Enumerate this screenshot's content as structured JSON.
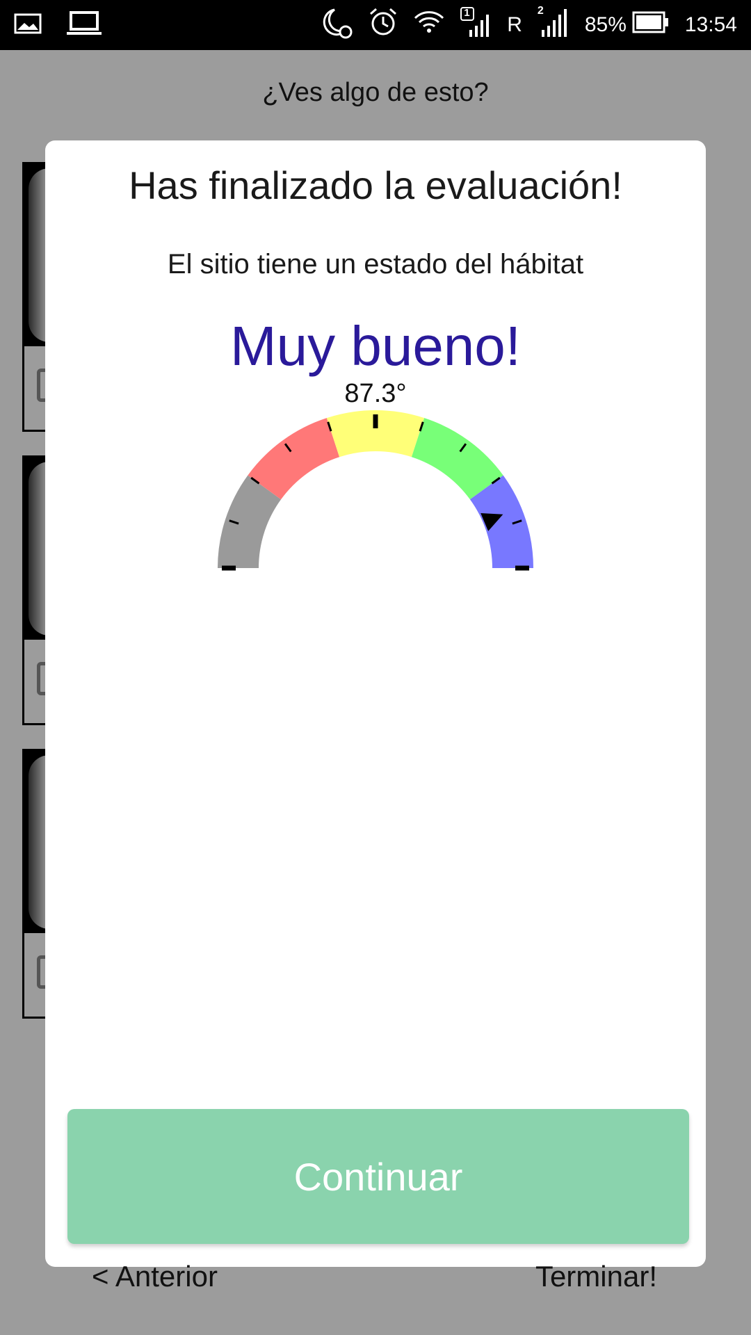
{
  "status_bar": {
    "wifi_sim_badge": "1",
    "roaming": "R",
    "sim2_badge": "2",
    "battery": "85%",
    "time": "13:54"
  },
  "page": {
    "question": "¿Ves algo de esto?"
  },
  "dialog": {
    "title": "Has finalizado la evaluación!",
    "subtitle": "El sitio tiene un estado del hábitat",
    "result": "Muy bueno!",
    "gauge": {
      "value_label": "87.3°",
      "value": 87.3,
      "min": 0,
      "max": 100,
      "segments": [
        {
          "color": "#9a9a9a"
        },
        {
          "color": "#ff7878"
        },
        {
          "color": "#ffff78"
        },
        {
          "color": "#78ff78"
        },
        {
          "color": "#7878ff"
        }
      ]
    },
    "continue_label": "Continuar"
  },
  "nav": {
    "prev_label": "< Anterior",
    "finish_label": "Terminar!"
  }
}
